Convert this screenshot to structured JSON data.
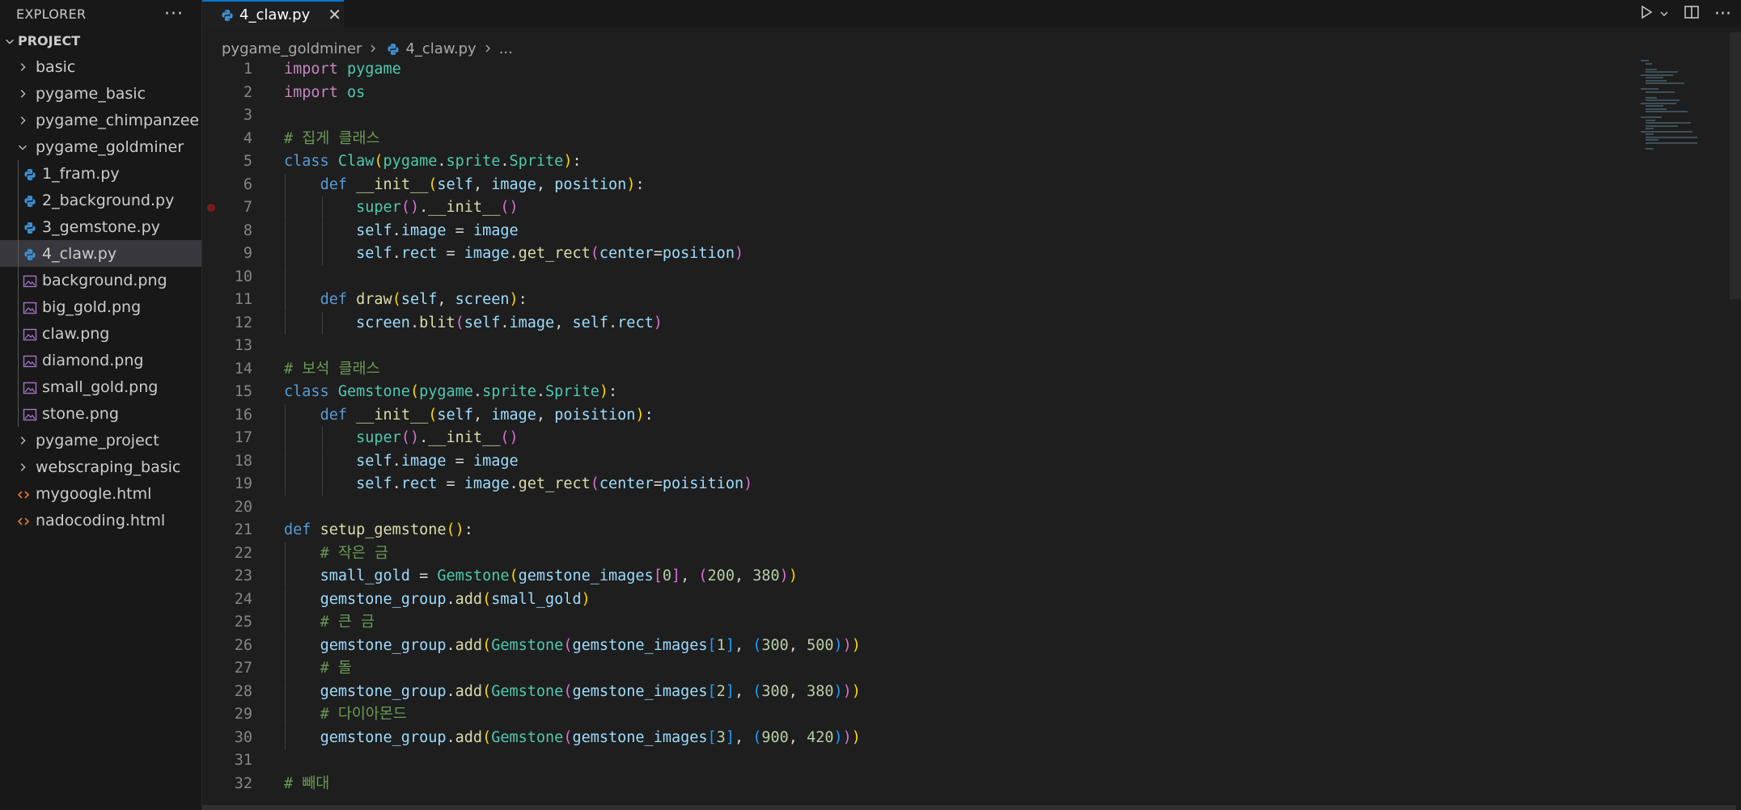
{
  "explorer": {
    "title": "EXPLORER",
    "more": "···",
    "project": "PROJECT",
    "items": [
      {
        "label": "basic",
        "type": "folder",
        "level": 0
      },
      {
        "label": "pygame_basic",
        "type": "folder",
        "level": 0
      },
      {
        "label": "pygame_chimpanzee",
        "type": "folder",
        "level": 0
      },
      {
        "label": "pygame_goldminer",
        "type": "folder-open",
        "level": 0
      },
      {
        "label": "1_fram.py",
        "type": "python",
        "level": 1
      },
      {
        "label": "2_background.py",
        "type": "python",
        "level": 1
      },
      {
        "label": "3_gemstone.py",
        "type": "python",
        "level": 1
      },
      {
        "label": "4_claw.py",
        "type": "python",
        "level": 1,
        "selected": true
      },
      {
        "label": "background.png",
        "type": "image",
        "level": 1
      },
      {
        "label": "big_gold.png",
        "type": "image",
        "level": 1
      },
      {
        "label": "claw.png",
        "type": "image",
        "level": 1
      },
      {
        "label": "diamond.png",
        "type": "image",
        "level": 1
      },
      {
        "label": "small_gold.png",
        "type": "image",
        "level": 1
      },
      {
        "label": "stone.png",
        "type": "image",
        "level": 1
      },
      {
        "label": "pygame_project",
        "type": "folder",
        "level": 0
      },
      {
        "label": "webscraping_basic",
        "type": "folder",
        "level": 0
      },
      {
        "label": "mygoogle.html",
        "type": "html",
        "level": 0
      },
      {
        "label": "nadocoding.html",
        "type": "html",
        "level": 0
      }
    ]
  },
  "tab": {
    "label": "4_claw.py",
    "close": "✕"
  },
  "breadcrumb": {
    "folder": "pygame_goldminer",
    "file": "4_claw.py",
    "more": "..."
  },
  "code": {
    "breakpoint_line": 7,
    "lines": [
      {
        "n": "1",
        "indent": 0,
        "tokens": [
          [
            "kw",
            "import"
          ],
          [
            "pl",
            " "
          ],
          [
            "mod",
            "pygame"
          ]
        ]
      },
      {
        "n": "2",
        "indent": 0,
        "tokens": [
          [
            "kw",
            "import"
          ],
          [
            "pl",
            " "
          ],
          [
            "mod",
            "os"
          ]
        ]
      },
      {
        "n": "3",
        "indent": 0,
        "tokens": []
      },
      {
        "n": "4",
        "indent": 0,
        "tokens": [
          [
            "cmt",
            "# 집게 클래스"
          ]
        ]
      },
      {
        "n": "5",
        "indent": 0,
        "tokens": [
          [
            "kw2",
            "class"
          ],
          [
            "pl",
            " "
          ],
          [
            "cls",
            "Claw"
          ],
          [
            "b1",
            "("
          ],
          [
            "mod",
            "pygame"
          ],
          [
            "pl",
            "."
          ],
          [
            "mod",
            "sprite"
          ],
          [
            "pl",
            "."
          ],
          [
            "cls",
            "Sprite"
          ],
          [
            "b1",
            ")"
          ],
          [
            "pl",
            ":"
          ]
        ]
      },
      {
        "n": "6",
        "indent": 1,
        "tokens": [
          [
            "pl",
            "    "
          ],
          [
            "kw2",
            "def"
          ],
          [
            "pl",
            " "
          ],
          [
            "fn",
            "__init__"
          ],
          [
            "b1",
            "("
          ],
          [
            "var",
            "self"
          ],
          [
            "pl",
            ", "
          ],
          [
            "var",
            "image"
          ],
          [
            "pl",
            ", "
          ],
          [
            "var",
            "position"
          ],
          [
            "b1",
            ")"
          ],
          [
            "pl",
            ":"
          ]
        ]
      },
      {
        "n": "7",
        "indent": 2,
        "tokens": [
          [
            "pl",
            "        "
          ],
          [
            "cls",
            "super"
          ],
          [
            "b2",
            "()"
          ],
          [
            "pl",
            "."
          ],
          [
            "fn",
            "__init__"
          ],
          [
            "b2",
            "()"
          ]
        ]
      },
      {
        "n": "8",
        "indent": 2,
        "tokens": [
          [
            "pl",
            "        "
          ],
          [
            "var",
            "self"
          ],
          [
            "pl",
            "."
          ],
          [
            "var",
            "image"
          ],
          [
            "pl",
            " = "
          ],
          [
            "var",
            "image"
          ]
        ]
      },
      {
        "n": "9",
        "indent": 2,
        "tokens": [
          [
            "pl",
            "        "
          ],
          [
            "var",
            "self"
          ],
          [
            "pl",
            "."
          ],
          [
            "var",
            "rect"
          ],
          [
            "pl",
            " = "
          ],
          [
            "var",
            "image"
          ],
          [
            "pl",
            "."
          ],
          [
            "fn",
            "get_rect"
          ],
          [
            "b2",
            "("
          ],
          [
            "var",
            "center"
          ],
          [
            "pl",
            "="
          ],
          [
            "var",
            "position"
          ],
          [
            "b2",
            ")"
          ]
        ]
      },
      {
        "n": "10",
        "indent": 1,
        "tokens": []
      },
      {
        "n": "11",
        "indent": 1,
        "tokens": [
          [
            "pl",
            "    "
          ],
          [
            "kw2",
            "def"
          ],
          [
            "pl",
            " "
          ],
          [
            "fn",
            "draw"
          ],
          [
            "b1",
            "("
          ],
          [
            "var",
            "self"
          ],
          [
            "pl",
            ", "
          ],
          [
            "var",
            "screen"
          ],
          [
            "b1",
            ")"
          ],
          [
            "pl",
            ":"
          ]
        ]
      },
      {
        "n": "12",
        "indent": 2,
        "tokens": [
          [
            "pl",
            "        "
          ],
          [
            "var",
            "screen"
          ],
          [
            "pl",
            "."
          ],
          [
            "fn",
            "blit"
          ],
          [
            "b2",
            "("
          ],
          [
            "var",
            "self"
          ],
          [
            "pl",
            "."
          ],
          [
            "var",
            "image"
          ],
          [
            "pl",
            ", "
          ],
          [
            "var",
            "self"
          ],
          [
            "pl",
            "."
          ],
          [
            "var",
            "rect"
          ],
          [
            "b2",
            ")"
          ]
        ]
      },
      {
        "n": "13",
        "indent": 0,
        "tokens": []
      },
      {
        "n": "14",
        "indent": 0,
        "tokens": [
          [
            "cmt",
            "# 보석 클래스"
          ]
        ]
      },
      {
        "n": "15",
        "indent": 0,
        "tokens": [
          [
            "kw2",
            "class"
          ],
          [
            "pl",
            " "
          ],
          [
            "cls",
            "Gemstone"
          ],
          [
            "b1",
            "("
          ],
          [
            "mod",
            "pygame"
          ],
          [
            "pl",
            "."
          ],
          [
            "mod",
            "sprite"
          ],
          [
            "pl",
            "."
          ],
          [
            "cls",
            "Sprite"
          ],
          [
            "b1",
            ")"
          ],
          [
            "pl",
            ":"
          ]
        ]
      },
      {
        "n": "16",
        "indent": 1,
        "tokens": [
          [
            "pl",
            "    "
          ],
          [
            "kw2",
            "def"
          ],
          [
            "pl",
            " "
          ],
          [
            "fn",
            "__init__"
          ],
          [
            "b1",
            "("
          ],
          [
            "var",
            "self"
          ],
          [
            "pl",
            ", "
          ],
          [
            "var",
            "image"
          ],
          [
            "pl",
            ", "
          ],
          [
            "var",
            "poisition"
          ],
          [
            "b1",
            ")"
          ],
          [
            "pl",
            ":"
          ]
        ]
      },
      {
        "n": "17",
        "indent": 2,
        "tokens": [
          [
            "pl",
            "        "
          ],
          [
            "cls",
            "super"
          ],
          [
            "b2",
            "()"
          ],
          [
            "pl",
            "."
          ],
          [
            "fn",
            "__init__"
          ],
          [
            "b2",
            "()"
          ]
        ]
      },
      {
        "n": "18",
        "indent": 2,
        "tokens": [
          [
            "pl",
            "        "
          ],
          [
            "var",
            "self"
          ],
          [
            "pl",
            "."
          ],
          [
            "var",
            "image"
          ],
          [
            "pl",
            " = "
          ],
          [
            "var",
            "image"
          ]
        ]
      },
      {
        "n": "19",
        "indent": 2,
        "tokens": [
          [
            "pl",
            "        "
          ],
          [
            "var",
            "self"
          ],
          [
            "pl",
            "."
          ],
          [
            "var",
            "rect"
          ],
          [
            "pl",
            " = "
          ],
          [
            "var",
            "image"
          ],
          [
            "pl",
            "."
          ],
          [
            "fn",
            "get_rect"
          ],
          [
            "b2",
            "("
          ],
          [
            "var",
            "center"
          ],
          [
            "pl",
            "="
          ],
          [
            "var",
            "poisition"
          ],
          [
            "b2",
            ")"
          ]
        ]
      },
      {
        "n": "20",
        "indent": 0,
        "tokens": []
      },
      {
        "n": "21",
        "indent": 0,
        "tokens": [
          [
            "kw2",
            "def"
          ],
          [
            "pl",
            " "
          ],
          [
            "fn",
            "setup_gemstone"
          ],
          [
            "b1",
            "()"
          ],
          [
            "pl",
            ":"
          ]
        ]
      },
      {
        "n": "22",
        "indent": 1,
        "tokens": [
          [
            "pl",
            "    "
          ],
          [
            "cmt",
            "# 작은 금"
          ]
        ]
      },
      {
        "n": "23",
        "indent": 1,
        "tokens": [
          [
            "pl",
            "    "
          ],
          [
            "var",
            "small_gold"
          ],
          [
            "pl",
            " = "
          ],
          [
            "cls",
            "Gemstone"
          ],
          [
            "b1",
            "("
          ],
          [
            "var",
            "gemstone_images"
          ],
          [
            "b2",
            "["
          ],
          [
            "num",
            "0"
          ],
          [
            "b2",
            "]"
          ],
          [
            "pl",
            ", "
          ],
          [
            "b2",
            "("
          ],
          [
            "num",
            "200"
          ],
          [
            "pl",
            ", "
          ],
          [
            "num",
            "380"
          ],
          [
            "b2",
            ")"
          ],
          [
            "b1",
            ")"
          ]
        ]
      },
      {
        "n": "24",
        "indent": 1,
        "tokens": [
          [
            "pl",
            "    "
          ],
          [
            "var",
            "gemstone_group"
          ],
          [
            "pl",
            "."
          ],
          [
            "fn",
            "add"
          ],
          [
            "b1",
            "("
          ],
          [
            "var",
            "small_gold"
          ],
          [
            "b1",
            ")"
          ]
        ]
      },
      {
        "n": "25",
        "indent": 1,
        "tokens": [
          [
            "pl",
            "    "
          ],
          [
            "cmt",
            "# 큰 금"
          ]
        ]
      },
      {
        "n": "26",
        "indent": 1,
        "tokens": [
          [
            "pl",
            "    "
          ],
          [
            "var",
            "gemstone_group"
          ],
          [
            "pl",
            "."
          ],
          [
            "fn",
            "add"
          ],
          [
            "b1",
            "("
          ],
          [
            "cls",
            "Gemstone"
          ],
          [
            "b2",
            "("
          ],
          [
            "var",
            "gemstone_images"
          ],
          [
            "b3",
            "["
          ],
          [
            "num",
            "1"
          ],
          [
            "b3",
            "]"
          ],
          [
            "pl",
            ", "
          ],
          [
            "b3",
            "("
          ],
          [
            "num",
            "300"
          ],
          [
            "pl",
            ", "
          ],
          [
            "num",
            "500"
          ],
          [
            "b3",
            ")"
          ],
          [
            "b2",
            ")"
          ],
          [
            "b1",
            ")"
          ]
        ]
      },
      {
        "n": "27",
        "indent": 1,
        "tokens": [
          [
            "pl",
            "    "
          ],
          [
            "cmt",
            "# 돌"
          ]
        ]
      },
      {
        "n": "28",
        "indent": 1,
        "tokens": [
          [
            "pl",
            "    "
          ],
          [
            "var",
            "gemstone_group"
          ],
          [
            "pl",
            "."
          ],
          [
            "fn",
            "add"
          ],
          [
            "b1",
            "("
          ],
          [
            "cls",
            "Gemstone"
          ],
          [
            "b2",
            "("
          ],
          [
            "var",
            "gemstone_images"
          ],
          [
            "b3",
            "["
          ],
          [
            "num",
            "2"
          ],
          [
            "b3",
            "]"
          ],
          [
            "pl",
            ", "
          ],
          [
            "b3",
            "("
          ],
          [
            "num",
            "300"
          ],
          [
            "pl",
            ", "
          ],
          [
            "num",
            "380"
          ],
          [
            "b3",
            ")"
          ],
          [
            "b2",
            ")"
          ],
          [
            "b1",
            ")"
          ]
        ]
      },
      {
        "n": "29",
        "indent": 1,
        "tokens": [
          [
            "pl",
            "    "
          ],
          [
            "cmt",
            "# 다이아몬드"
          ]
        ]
      },
      {
        "n": "30",
        "indent": 1,
        "tokens": [
          [
            "pl",
            "    "
          ],
          [
            "var",
            "gemstone_group"
          ],
          [
            "pl",
            "."
          ],
          [
            "fn",
            "add"
          ],
          [
            "b1",
            "("
          ],
          [
            "cls",
            "Gemstone"
          ],
          [
            "b2",
            "("
          ],
          [
            "var",
            "gemstone_images"
          ],
          [
            "b3",
            "["
          ],
          [
            "num",
            "3"
          ],
          [
            "b3",
            "]"
          ],
          [
            "pl",
            ", "
          ],
          [
            "b3",
            "("
          ],
          [
            "num",
            "900"
          ],
          [
            "pl",
            ", "
          ],
          [
            "num",
            "420"
          ],
          [
            "b3",
            ")"
          ],
          [
            "b2",
            ")"
          ],
          [
            "b1",
            ")"
          ]
        ]
      },
      {
        "n": "31",
        "indent": 0,
        "tokens": []
      },
      {
        "n": "32",
        "indent": 0,
        "tokens": [
          [
            "cmt",
            "# 빼대"
          ]
        ]
      }
    ]
  }
}
